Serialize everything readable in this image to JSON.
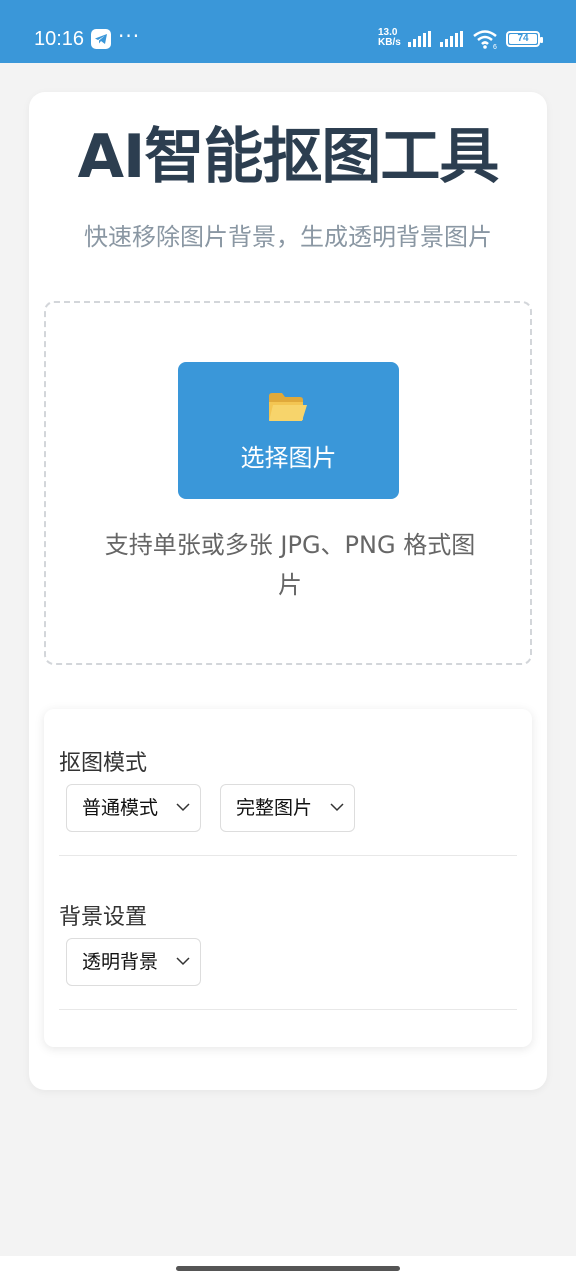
{
  "status_bar": {
    "time": "10:16",
    "app_icon": "telegram-icon",
    "more": "···",
    "net_speed_value": "13.0",
    "net_speed_unit": "KB/s",
    "battery": "74",
    "background": "#3a97d9"
  },
  "header": {
    "title": "AI智能抠图工具",
    "subtitle": "快速移除图片背景，生成透明背景图片"
  },
  "upload": {
    "icon": "open-folder-icon",
    "button_label": "选择图片",
    "hint": "支持单张或多张 JPG、PNG 格式图片"
  },
  "settings": {
    "mode_label": "抠图模式",
    "mode_select": "普通模式",
    "area_select": "完整图片",
    "bg_label": "背景设置",
    "bg_select": "透明背景"
  },
  "colors": {
    "accent": "#3a97d9",
    "title": "#2c3e50",
    "subtitle": "#8a97a3",
    "page_bg": "#f3f3f3"
  }
}
